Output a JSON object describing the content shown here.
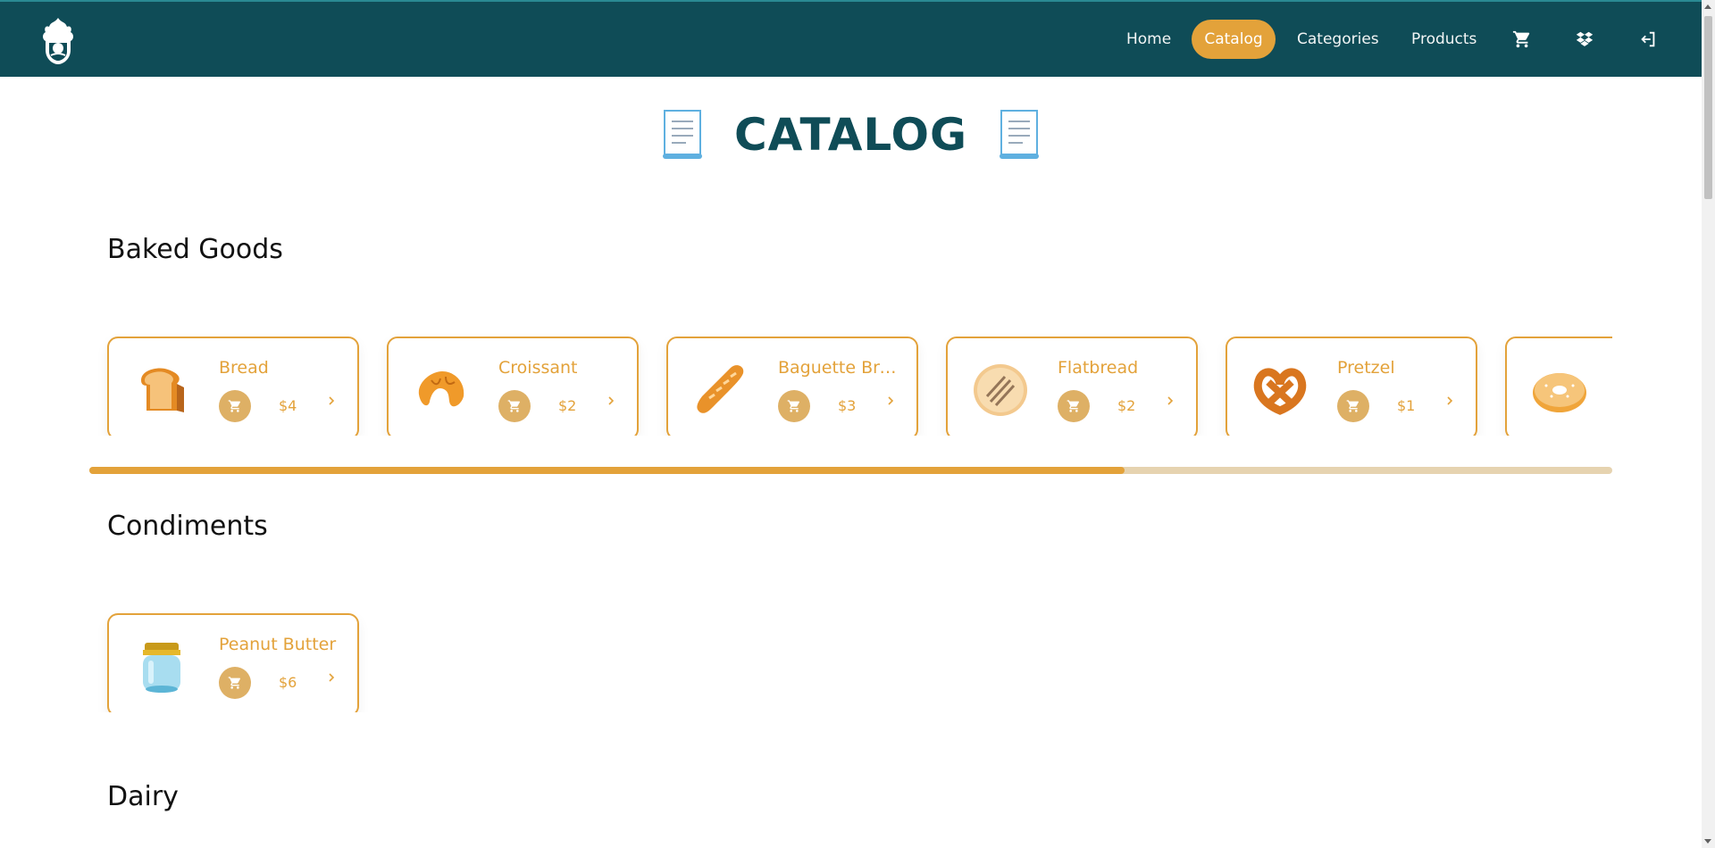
{
  "nav": {
    "items": [
      {
        "label": "Home",
        "active": false
      },
      {
        "label": "Catalog",
        "active": true
      },
      {
        "label": "Categories",
        "active": false
      },
      {
        "label": "Products",
        "active": false
      }
    ],
    "icons": [
      "cart-icon",
      "dropbox-icon",
      "logout-icon"
    ]
  },
  "page": {
    "title": "CATALOG",
    "title_icon": "scroll-icon"
  },
  "sections": [
    {
      "title": "Baked Goods",
      "products": [
        {
          "name": "Bread",
          "price": "$4",
          "icon": "bread-icon"
        },
        {
          "name": "Croissant",
          "price": "$2",
          "icon": "croissant-icon"
        },
        {
          "name": "Baguette Bread",
          "price": "$3",
          "icon": "baguette-icon"
        },
        {
          "name": "Flatbread",
          "price": "$2",
          "icon": "flatbread-icon"
        },
        {
          "name": "Pretzel",
          "price": "$1",
          "icon": "pretzel-icon"
        },
        {
          "name": "",
          "price": "",
          "icon": "bagel-icon"
        }
      ],
      "scroll_progress": 0.68
    },
    {
      "title": "Condiments",
      "products": [
        {
          "name": "Peanut Butter",
          "price": "$6",
          "icon": "jar-icon"
        }
      ]
    },
    {
      "title": "Dairy",
      "products": []
    }
  ],
  "colors": {
    "nav_bg": "#0f4c57",
    "accent": "#e3a23a",
    "cart_button": "#deb065",
    "title": "#0f4c57"
  }
}
